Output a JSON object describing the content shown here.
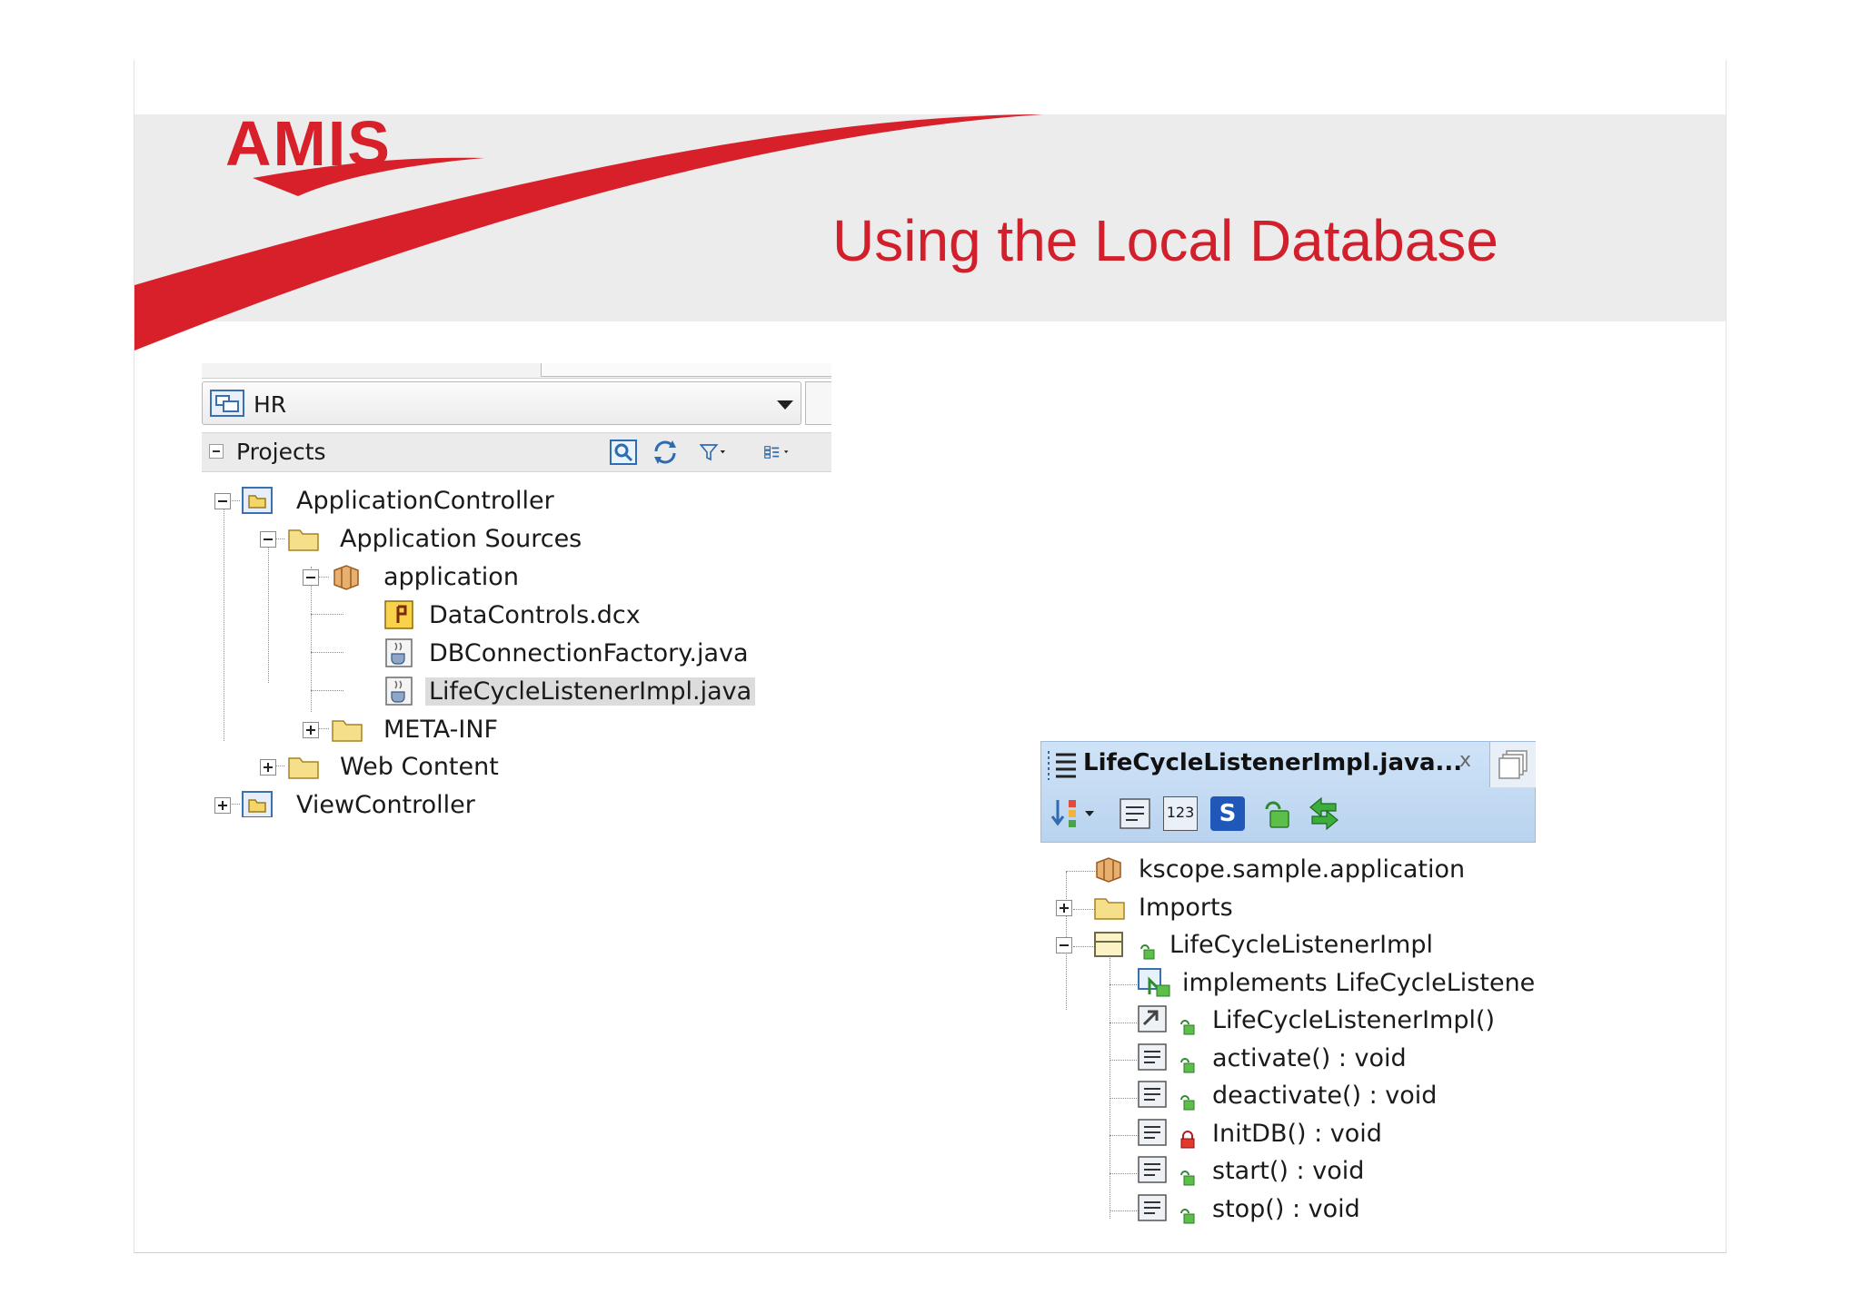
{
  "slide": {
    "logo_text": "AMIS",
    "title": "Using the Local Database",
    "colors": {
      "brand_red": "#d8202a",
      "header_band": "#ececec"
    }
  },
  "navigator": {
    "application_selector": "HR",
    "projects_label": "Projects",
    "toolbar_icons": [
      "search-icon",
      "refresh-icon",
      "filter-icon",
      "tree-options-icon"
    ],
    "tree": [
      {
        "label": "ApplicationController",
        "icon": "project-icon",
        "state": "expanded"
      },
      {
        "label": "Application Sources",
        "icon": "folder-icon",
        "state": "expanded"
      },
      {
        "label": "application",
        "icon": "package-icon",
        "state": "expanded"
      },
      {
        "label": "DataControls.dcx",
        "icon": "dcx-file-icon"
      },
      {
        "label": "DBConnectionFactory.java",
        "icon": "java-file-icon"
      },
      {
        "label": "LifeCycleListenerImpl.java",
        "icon": "java-file-icon",
        "selected": true
      },
      {
        "label": "META-INF",
        "icon": "folder-icon",
        "state": "collapsed"
      },
      {
        "label": "Web Content",
        "icon": "folder-icon",
        "state": "collapsed"
      },
      {
        "label": "ViewController",
        "icon": "project-icon",
        "state": "collapsed"
      }
    ]
  },
  "structure": {
    "title": "LifeCycleListenerImpl.java...",
    "close_label": "x",
    "toolbar_icons": [
      "sort-icon",
      "show-members-icon",
      "show-fields-icon",
      "static-icon",
      "public-icon",
      "sync-icon"
    ],
    "static_label": "S",
    "fields_label": "123",
    "tree": [
      {
        "label": "kscope.sample.application",
        "icon": "package-icon"
      },
      {
        "label": "Imports",
        "icon": "folder-icon",
        "state": "collapsed"
      },
      {
        "label": "LifeCycleListenerImpl",
        "icon": "class-icon",
        "state": "expanded",
        "access": "public"
      },
      {
        "label": "implements LifeCycleListener",
        "icon": "interface-icon"
      },
      {
        "label": "LifeCycleListenerImpl()",
        "icon": "constructor-icon",
        "access": "public"
      },
      {
        "label": "activate()  : void",
        "icon": "method-icon",
        "access": "public"
      },
      {
        "label": "deactivate()  : void",
        "icon": "method-icon",
        "access": "public"
      },
      {
        "label": "InitDB()  : void",
        "icon": "method-icon",
        "access": "private"
      },
      {
        "label": "start()  : void",
        "icon": "method-icon",
        "access": "public"
      },
      {
        "label": "stop()  : void",
        "icon": "method-icon",
        "access": "public"
      }
    ]
  }
}
